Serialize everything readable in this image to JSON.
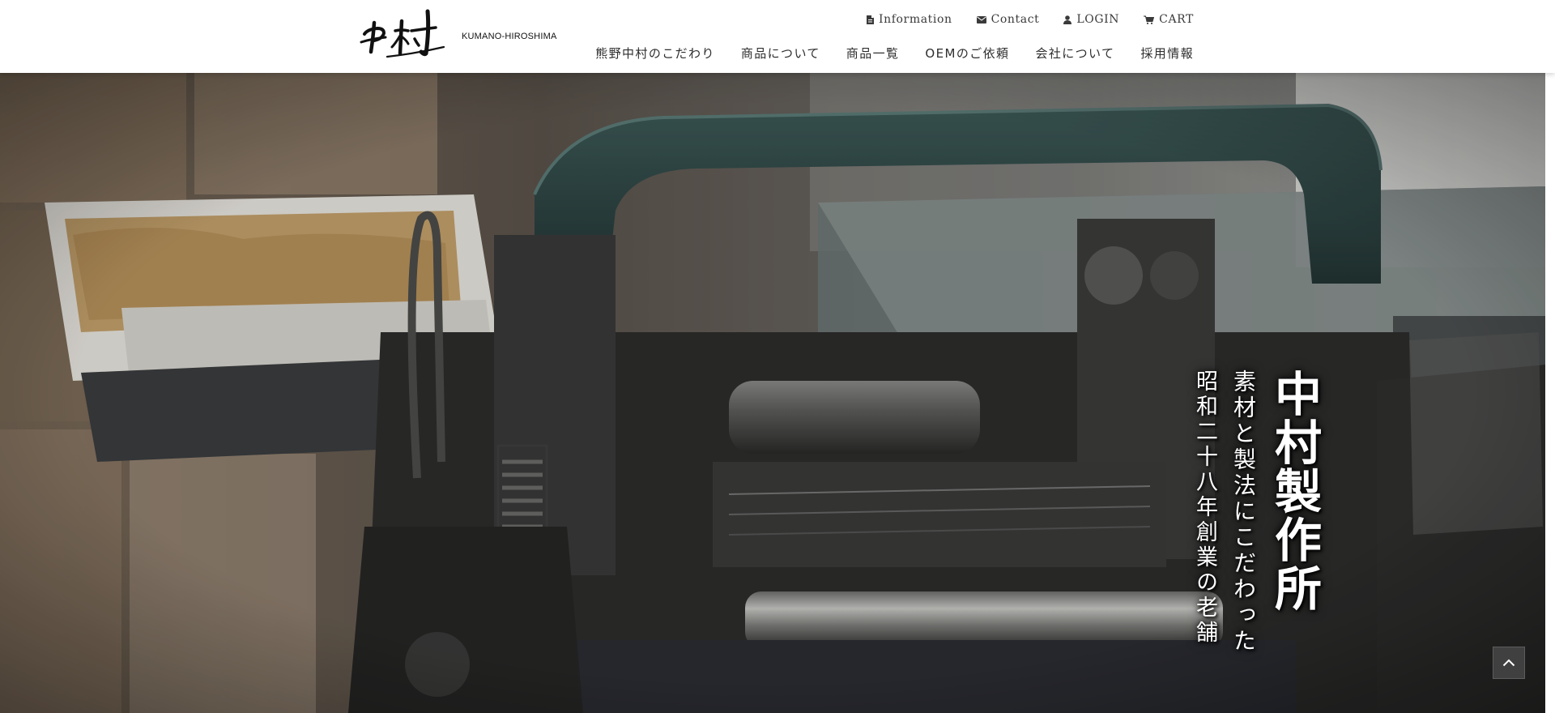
{
  "brand": {
    "logo_text": "中村",
    "subtitle": "KUMANO-HIROSHIMA"
  },
  "util_nav": [
    {
      "label": "Information",
      "icon": "document-icon"
    },
    {
      "label": "Contact",
      "icon": "envelope-icon"
    },
    {
      "label": "LOGIN",
      "icon": "user-icon"
    },
    {
      "label": "CART",
      "icon": "cart-icon"
    }
  ],
  "main_nav": [
    {
      "label": "熊野中村のこだわり"
    },
    {
      "label": "商品について"
    },
    {
      "label": "商品一覧"
    },
    {
      "label": "OEMのご依頼"
    },
    {
      "label": "会社について"
    },
    {
      "label": "採用情報"
    }
  ],
  "hero": {
    "title": "中村製作所",
    "line1": "素材と製法にこだわった",
    "line2": "昭和二十八年創業の老舗"
  },
  "to_top": {
    "icon": "chevron-up-icon"
  },
  "colors": {
    "header_bg": "#ffffff",
    "nav_text": "#2e2e2e",
    "hero_text": "#ffffff",
    "machine_teal": "#2f4a49"
  }
}
